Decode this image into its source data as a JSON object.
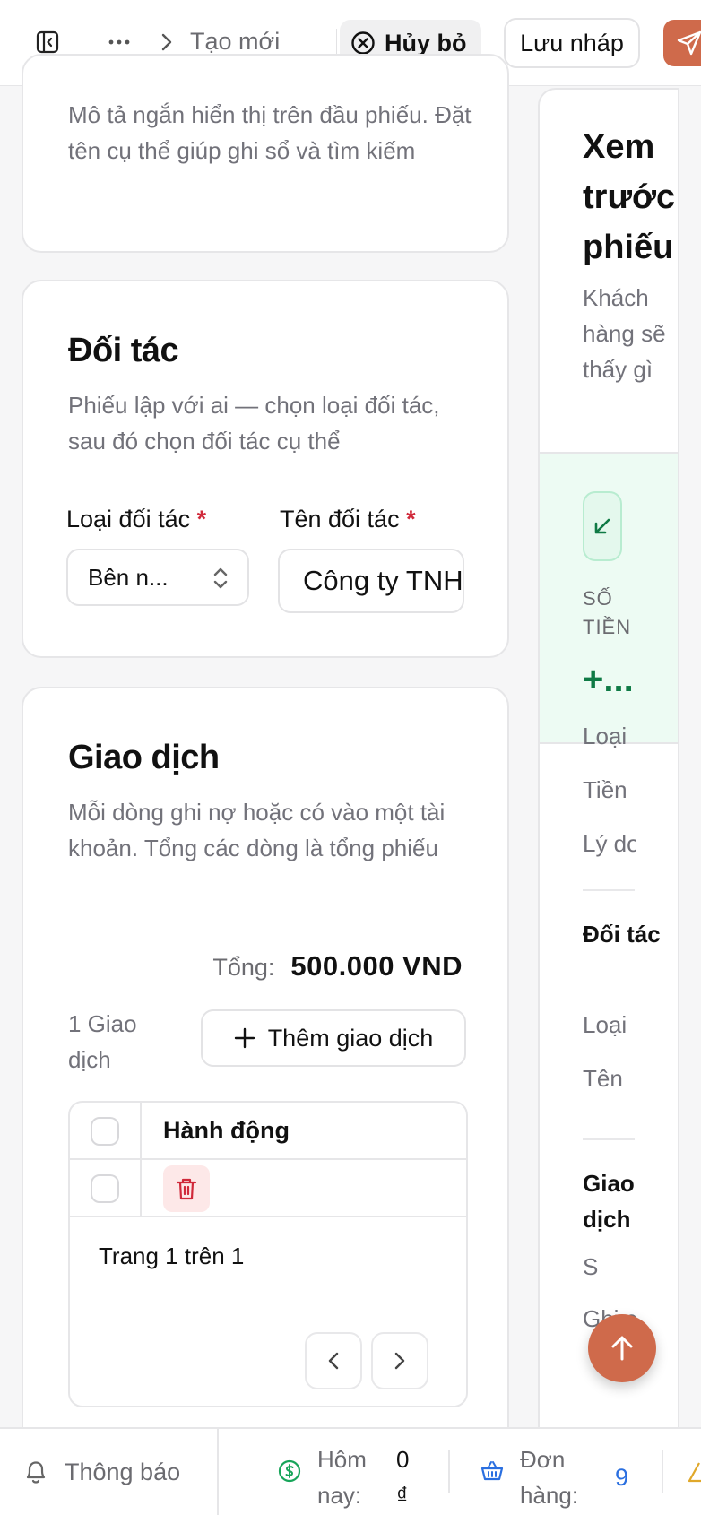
{
  "header": {
    "breadcrumb_current": "Tạo mới",
    "cancel_label": "Hủy bỏ",
    "draft_label": "Lưu nháp"
  },
  "card_info": {
    "description": "Mô tả ngắn hiển thị trên đầu phiếu. Đặt tên cụ thể giúp ghi sổ và tìm kiếm"
  },
  "partner": {
    "title": "Đối tác",
    "description": "Phiếu lập với ai — chọn loại đối tác, sau đó chọn đối tác cụ thể",
    "type_label": "Loại đối tác",
    "name_label": "Tên đối tác",
    "required_mark": "*",
    "type_value": "Bên n...",
    "name_value": "Công ty TNHH"
  },
  "transactions": {
    "title": "Giao dịch",
    "description": "Mỗi dòng ghi nợ hoặc có vào một tài khoản. Tổng các dòng là tổng phiếu",
    "total_label": "Tổng:",
    "total_value": "500.000 VND",
    "count_text": "1 Giao dịch",
    "add_label": "Thêm giao dịch",
    "column_action": "Hành động",
    "pager_text": "Trang 1 trên 1"
  },
  "preview": {
    "title": "Xem trước phiếu",
    "subtitle": "Khách hàng sẽ thấy gì",
    "amount_label": "SỐ TIỀN",
    "amount_value": "+...",
    "line_type": "Loại",
    "line_money": "Tiền",
    "line_reason": "Lý do",
    "section_partner": "Đối tác",
    "line_partner_type": "Loại",
    "line_partner_name": "Tên",
    "section_transactions": "Giao dịch",
    "line_s": "S",
    "line_note": "Ghi ch"
  },
  "bottombar": {
    "notifications": "Thông báo",
    "today_label": "Hôm nay:",
    "today_value": "0 ₫",
    "orders_label": "Đơn hàng:",
    "orders_value": "9"
  },
  "colors": {
    "accent": "#cf6a4b",
    "success": "#0f7a45",
    "danger": "#d0293a"
  }
}
